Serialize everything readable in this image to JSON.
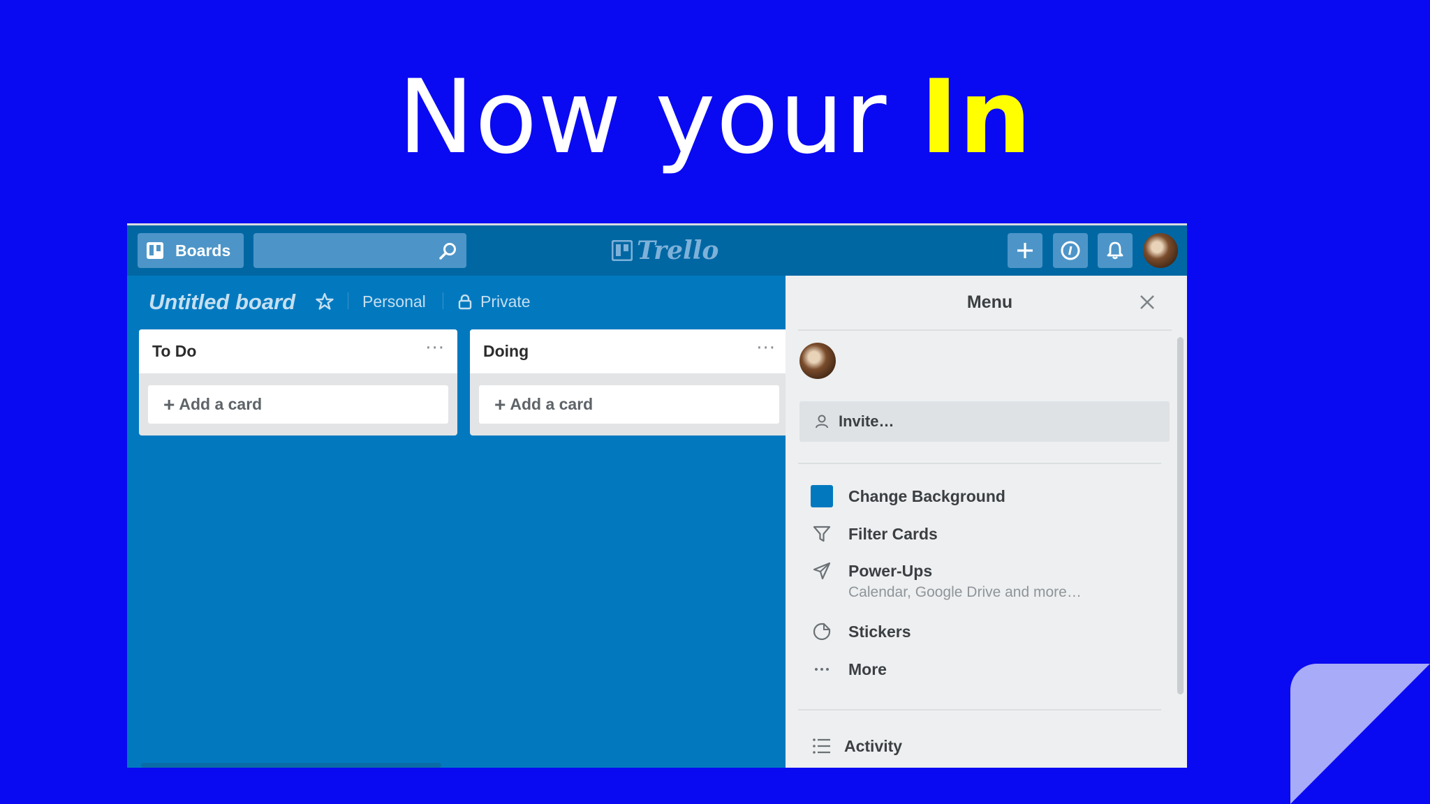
{
  "slide": {
    "title_prefix": "Now your ",
    "title_highlight": "In"
  },
  "header": {
    "boards_label": "Boards",
    "search_placeholder": "",
    "logo_text": "Trello"
  },
  "board": {
    "title": "Untitled board",
    "team": "Personal",
    "visibility": "Private",
    "background_color": "#0279bf"
  },
  "lists": [
    {
      "title": "To Do",
      "menu": "···",
      "add_label": "Add a card"
    },
    {
      "title": "Doing",
      "menu": "···",
      "add_label": "Add a card"
    }
  ],
  "menu": {
    "title": "Menu",
    "invite_label": "Invite…",
    "items": [
      {
        "icon": "color-swatch",
        "label": "Change Background",
        "sub": ""
      },
      {
        "icon": "filter-icon",
        "label": "Filter Cards",
        "sub": ""
      },
      {
        "icon": "rocket-icon",
        "label": "Power-Ups",
        "sub": "Calendar, Google Drive and more…"
      },
      {
        "icon": "sticker-icon",
        "label": "Stickers",
        "sub": ""
      },
      {
        "icon": "more-icon",
        "label": "More",
        "sub": ""
      }
    ],
    "activity_label": "Activity"
  },
  "colors": {
    "slide_background": "#0a0af2",
    "title_highlight": "#ffff00",
    "header_background": "#0067a3",
    "board_background": "#0279bf",
    "menu_background": "#edeff0"
  }
}
